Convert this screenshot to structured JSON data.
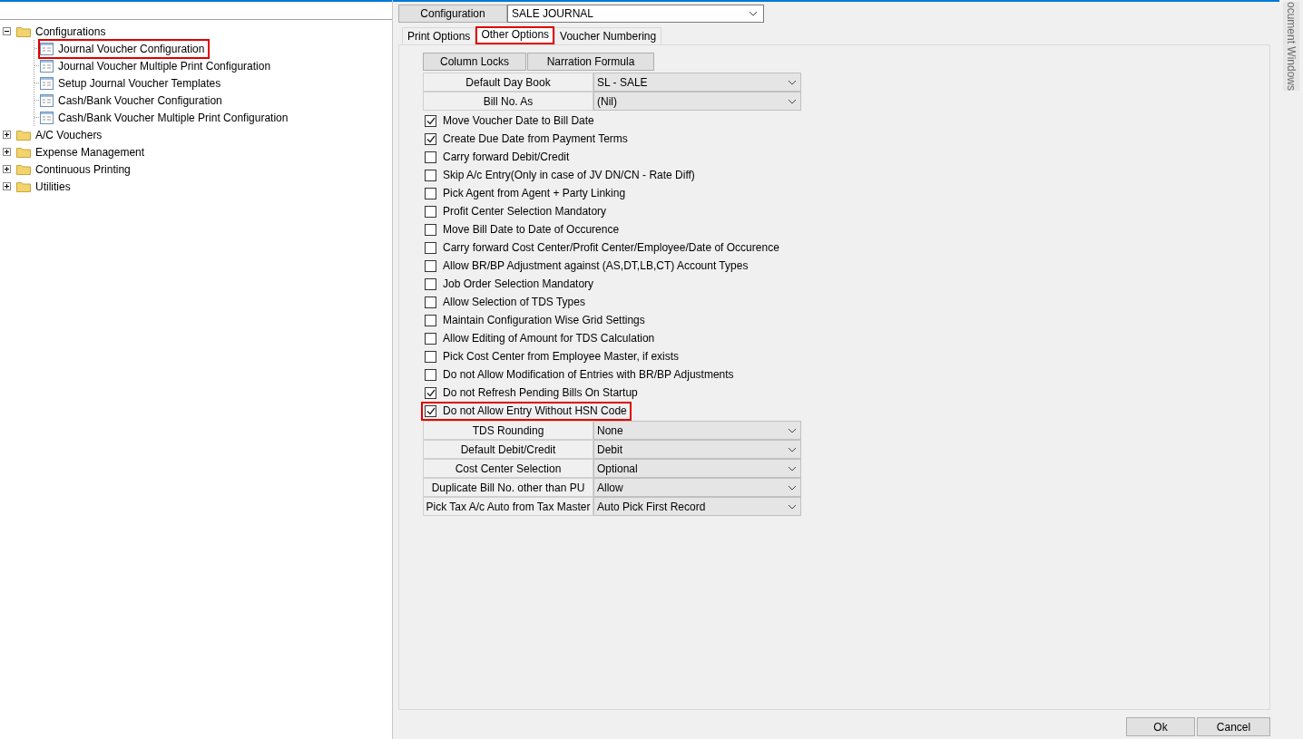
{
  "tree": [
    {
      "label": "Configurations",
      "kind": "folder",
      "expanded": true,
      "children": [
        {
          "label": "Journal Voucher Configuration",
          "kind": "form",
          "highlighted": true
        },
        {
          "label": "Journal Voucher Multiple Print Configuration",
          "kind": "form",
          "highlighted": false
        },
        {
          "label": "Setup Journal Voucher Templates",
          "kind": "form",
          "highlighted": false
        },
        {
          "label": "Cash/Bank Voucher Configuration",
          "kind": "form",
          "highlighted": false
        },
        {
          "label": "Cash/Bank Voucher Multiple Print Configuration",
          "kind": "form",
          "highlighted": false
        }
      ]
    },
    {
      "label": "A/C Vouchers",
      "kind": "folder",
      "expanded": false
    },
    {
      "label": "Expense Management",
      "kind": "folder",
      "expanded": false
    },
    {
      "label": "Continuous Printing",
      "kind": "folder",
      "expanded": false
    },
    {
      "label": "Utilities",
      "kind": "folder",
      "expanded": false
    }
  ],
  "configuration": {
    "label": "Configuration",
    "value": "SALE JOURNAL"
  },
  "tabs": [
    {
      "label": "Print Options",
      "selected": false,
      "highlighted": false
    },
    {
      "label": "Other Options",
      "selected": true,
      "highlighted": true
    },
    {
      "label": "Voucher Numbering",
      "selected": false,
      "highlighted": false
    }
  ],
  "action_buttons": [
    "Column Locks",
    "Narration Formula"
  ],
  "top_settings": [
    {
      "label": "Default Day Book",
      "value": "SL - SALE"
    },
    {
      "label": "Bill No. As",
      "value": "(Nil)"
    }
  ],
  "options": [
    {
      "label": "Move Voucher Date to Bill Date",
      "checked": true,
      "highlighted": false
    },
    {
      "label": "Create Due Date from Payment Terms",
      "checked": true,
      "highlighted": false
    },
    {
      "label": "Carry forward Debit/Credit",
      "checked": false,
      "highlighted": false
    },
    {
      "label": "Skip A/c Entry(Only in case of JV DN/CN - Rate Diff)",
      "checked": false,
      "highlighted": false
    },
    {
      "label": "Pick Agent from Agent + Party Linking",
      "checked": false,
      "highlighted": false
    },
    {
      "label": "Profit Center Selection Mandatory",
      "checked": false,
      "highlighted": false
    },
    {
      "label": "Move Bill Date to Date of Occurence",
      "checked": false,
      "highlighted": false
    },
    {
      "label": "Carry forward Cost Center/Profit Center/Employee/Date of Occurence",
      "checked": false,
      "highlighted": false
    },
    {
      "label": "Allow BR/BP Adjustment against (AS,DT,LB,CT) Account Types",
      "checked": false,
      "highlighted": false
    },
    {
      "label": "Job Order Selection Mandatory",
      "checked": false,
      "highlighted": false
    },
    {
      "label": "Allow Selection of TDS Types",
      "checked": false,
      "highlighted": false
    },
    {
      "label": "Maintain Configuration Wise Grid Settings",
      "checked": false,
      "highlighted": false
    },
    {
      "label": "Allow Editing of Amount for TDS Calculation",
      "checked": false,
      "highlighted": false
    },
    {
      "label": "Pick Cost Center from Employee Master, if exists",
      "checked": false,
      "highlighted": false
    },
    {
      "label": "Do not Allow Modification of Entries with BR/BP Adjustments",
      "checked": false,
      "highlighted": false
    },
    {
      "label": "Do not Refresh Pending Bills On Startup",
      "checked": true,
      "highlighted": false
    },
    {
      "label": "Do not Allow Entry Without HSN Code",
      "checked": true,
      "highlighted": true
    }
  ],
  "bottom_settings": [
    {
      "label": "TDS Rounding",
      "value": "None"
    },
    {
      "label": "Default Debit/Credit",
      "value": "Debit"
    },
    {
      "label": "Cost Center Selection",
      "value": "Optional"
    },
    {
      "label": "Duplicate Bill No. other than PU",
      "value": "Allow"
    },
    {
      "label": "Pick Tax A/c Auto from Tax Master",
      "value": "Auto Pick First Record"
    }
  ],
  "dialog_buttons": [
    "Ok",
    "Cancel"
  ],
  "side_tab": "ocument Windows"
}
